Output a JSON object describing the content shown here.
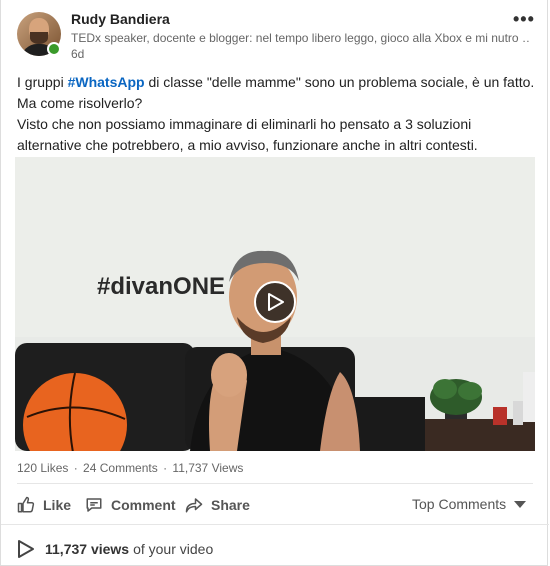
{
  "author": {
    "name": "Rudy Bandiera",
    "headline": "TEDx speaker, docente e blogger: nel tempo libero leggo, gioco alla Xbox e mi nutro …",
    "time": "6d"
  },
  "menu": {
    "more_label": "•••"
  },
  "post": {
    "text_before": "I gruppi ",
    "hashtag": "#WhatsApp",
    "text_after": " di classe \"delle mamme\" sono un problema sociale, è un fatto. Ma come risolverlo?",
    "line2": "Visto che non possiamo immaginare di eliminarli ho pensato a 3 soluzioni alternative che potrebbero, a mio avviso, funzionare anche in altri contesti."
  },
  "video": {
    "wall_text": "#divanONE"
  },
  "stats": {
    "likes": "120 Likes",
    "sep1": " · ",
    "comments": "24 Comments",
    "sep2": " · ",
    "views": "11,737 Views"
  },
  "actions": {
    "like": "Like",
    "comment": "Comment",
    "share": "Share",
    "sort": "Top Comments"
  },
  "views_footer": {
    "count": "11,737 views",
    "suffix": "of your video"
  },
  "colors": {
    "accent": "#0a66c2",
    "online": "#3a9a2a"
  }
}
